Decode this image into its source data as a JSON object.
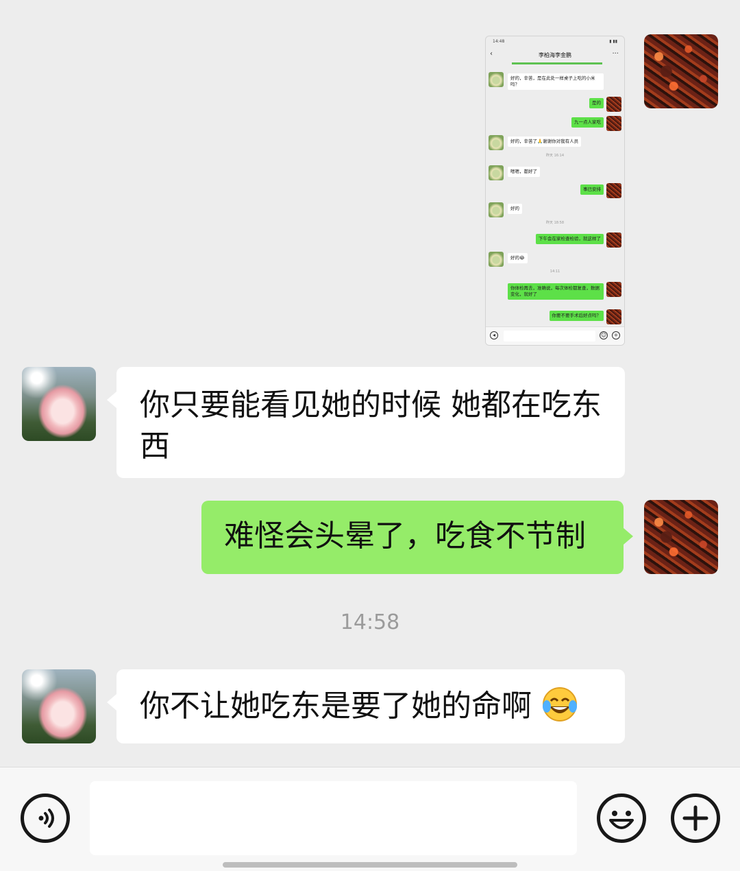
{
  "thumbnail": {
    "status_time": "14:48",
    "title": "李柏海李金鹏",
    "messages": [
      {
        "dir": "in",
        "text": "好的，辛苦，是在此处一样桌子上吃的小米吗？"
      },
      {
        "dir": "out",
        "text": "是的"
      },
      {
        "dir": "out",
        "text": "九一点人家吃"
      },
      {
        "dir": "in",
        "text": "好的，辛苦了🙏谢谢你对我有人员"
      },
      {
        "dir": "ts",
        "text": "昨天 16:14"
      },
      {
        "dir": "in",
        "text": "嗯嗯，都好了"
      },
      {
        "dir": "out",
        "text": "事已安排"
      },
      {
        "dir": "in",
        "text": "好的"
      },
      {
        "dir": "ts",
        "text": "昨天 18:58"
      },
      {
        "dir": "out",
        "text": "下午会在家检查检验，就这样了"
      },
      {
        "dir": "in",
        "text": "好的😂"
      },
      {
        "dir": "ts",
        "text": "14:11"
      },
      {
        "dir": "out",
        "text": "你体检再去，准确说，每次体检都复查，数据变化，就好了"
      },
      {
        "dir": "out",
        "text": "你要不要手术后好点吗？"
      }
    ]
  },
  "messages": {
    "msg1": "你只要能看见她的时候 她都在吃东西",
    "msg2": "难怪会头晕了，吃食不节制",
    "timestamp": "14:58",
    "msg3": "你不让她吃东是要了她的命啊"
  },
  "input": {
    "voice_icon": "voice-icon",
    "emoji_icon": "emoji-icon",
    "plus_icon": "plus-icon",
    "placeholder": ""
  },
  "colors": {
    "background": "#ededed",
    "outgoing_bubble": "#95ec69",
    "incoming_bubble": "#ffffff",
    "timestamp": "#9b9b9b"
  }
}
